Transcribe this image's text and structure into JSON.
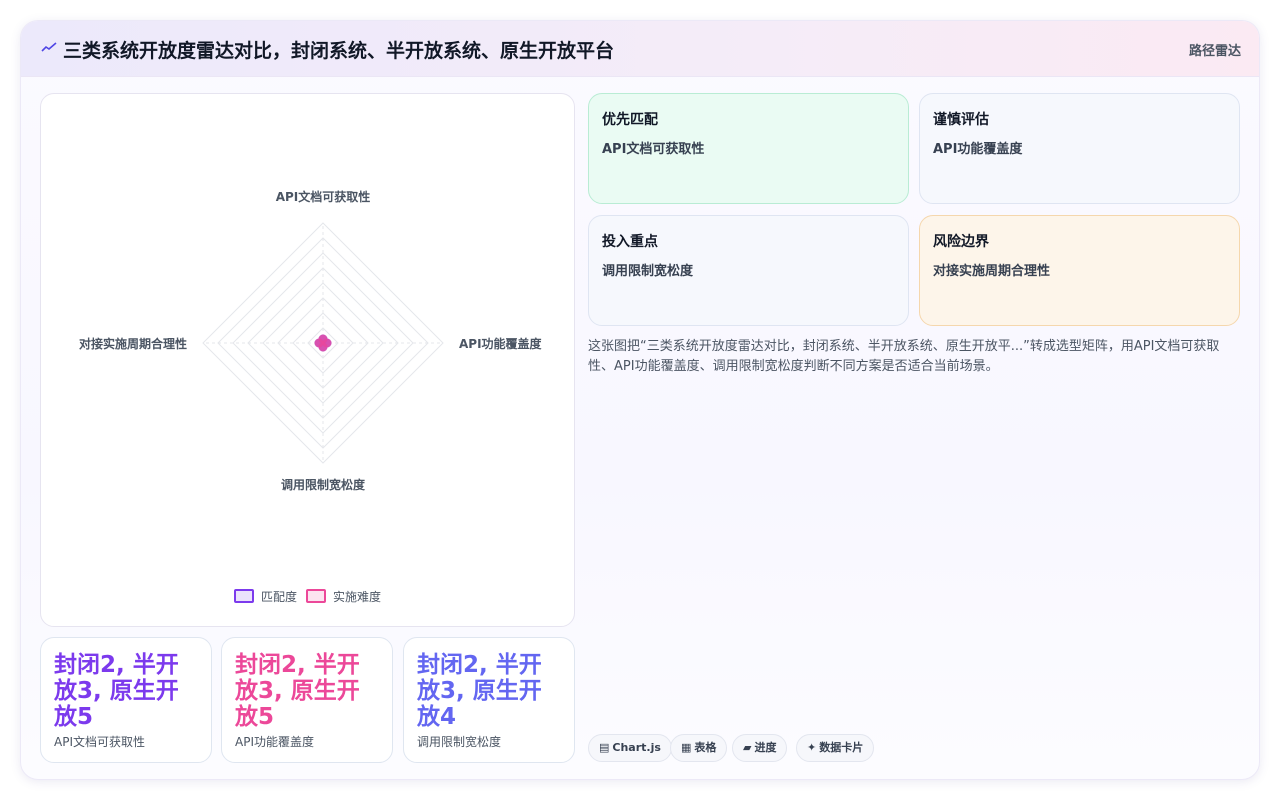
{
  "header": {
    "title": "三类系统开放度雷达对比，封闭系统、半开放系统、原生开放平台",
    "badge": "路径雷达"
  },
  "chart_data": {
    "type": "radar",
    "axes": [
      "API文档可获取性",
      "API功能覆盖度",
      "调用限制宽松度",
      "对接实施周期合理性"
    ],
    "series": [
      {
        "name": "匹配度",
        "values": [
          0,
          0,
          0,
          0
        ],
        "color": "#7c3aed"
      },
      {
        "name": "实施难度",
        "values": [
          0,
          0,
          0,
          0
        ],
        "color": "#ec4899"
      }
    ],
    "grid": true,
    "legend_position": "bottom"
  },
  "stats": [
    {
      "value": "封闭2, 半开放3, 原生开放5",
      "label": "API文档可获取性",
      "color": "#7c3aed"
    },
    {
      "value": "封闭2, 半开放3, 原生开放5",
      "label": "API功能覆盖度",
      "color": "#ec4899"
    },
    {
      "value": "封闭2, 半开放3, 原生开放4",
      "label": "调用限制宽松度",
      "color": "#6366f1"
    }
  ],
  "tiles": [
    {
      "title": "优先匹配",
      "text": "API文档可获取性",
      "bg": "#eafbf3",
      "border": "#b9ecd4"
    },
    {
      "title": "谨慎评估",
      "text": "API功能覆盖度",
      "bg": "#f6f8fd",
      "border": "#dfe5f2"
    },
    {
      "title": "投入重点",
      "text": "调用限制宽松度",
      "bg": "#f6f8fd",
      "border": "#dfe5f2"
    },
    {
      "title": "风险边界",
      "text": "对接实施周期合理性",
      "bg": "#fdf5ea",
      "border": "#f5d7ad"
    }
  ],
  "summary": "这张图把“三类系统开放度雷达对比，封闭系统、半开放系统、原生开放平...”转成选型矩阵，用API文档可获取性、API功能覆盖度、调用限制宽松度判断不同方案是否适合当前场景。",
  "chips": [
    {
      "icon": "▤",
      "label": "Chart.js",
      "icon_name": "chart-icon"
    },
    {
      "icon": "▦",
      "label": "表格",
      "icon_name": "table-icon"
    },
    {
      "icon": "▰",
      "label": "进度",
      "icon_name": "progress-icon"
    },
    {
      "icon": "✦",
      "label": "数据卡片",
      "icon_name": "card-icon"
    }
  ]
}
